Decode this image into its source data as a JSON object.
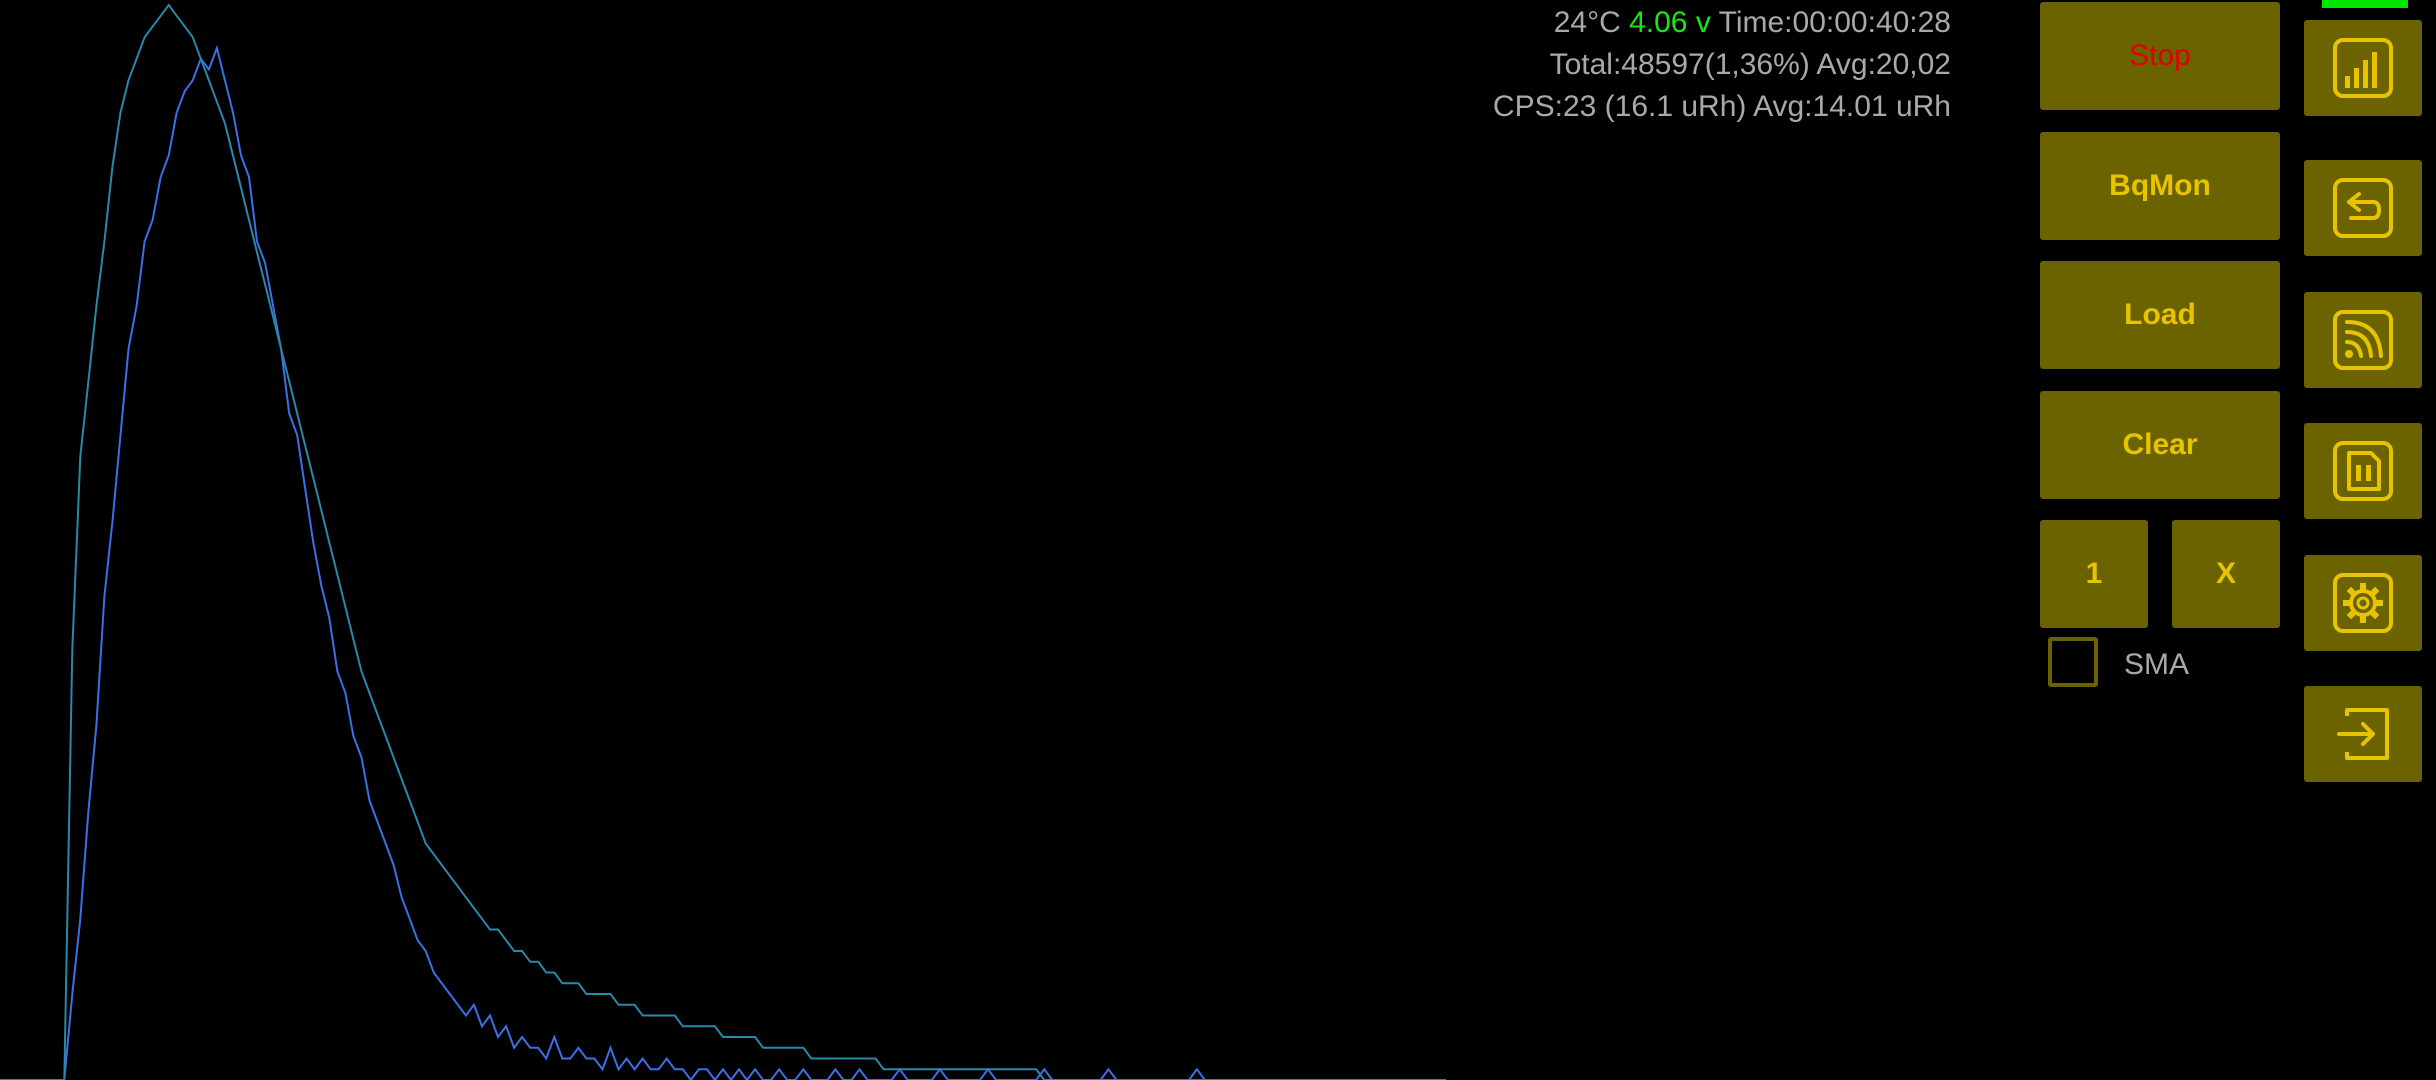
{
  "status": {
    "temperature": "24°C",
    "voltage": "4.06 v",
    "time": "Time:00:00:40:28",
    "total": "Total:48597(1,36%) Avg:20,02",
    "cps": "CPS:23 (16.1 uRh) Avg:14.01 uRh"
  },
  "controls": {
    "stop_label": "Stop",
    "bqmon_label": "BqMon",
    "load_label": "Load",
    "clear_label": "Clear",
    "one_label": "1",
    "x_label": "X",
    "sma_label": "SMA",
    "sma_checked": false
  },
  "side_icons": [
    "spectrum-bars-icon",
    "back-arrow-icon",
    "broadcast-icon",
    "sd-card-icon",
    "gear-icon",
    "exit-icon"
  ],
  "colors": {
    "background": "#000000",
    "button_bg": "#6b6300",
    "button_text": "#e8c300",
    "stop_text": "#e10000",
    "voltage_text": "#19e619",
    "status_text": "#a9a9a9",
    "series_current": "#3d6fe8",
    "series_total": "#2a88a8",
    "battery_indicator": "#00e600"
  },
  "chart_data": {
    "type": "line",
    "series": [
      {
        "values": [
          0,
          0,
          0,
          0,
          0,
          0,
          0,
          0,
          0,
          8,
          15,
          25,
          33,
          45,
          52,
          60,
          68,
          72,
          78,
          80,
          84,
          86,
          90,
          92,
          93,
          95,
          94,
          96,
          93,
          90,
          86,
          84,
          78,
          76,
          72,
          68,
          62,
          60,
          55,
          50,
          46,
          43,
          38,
          36,
          32,
          30,
          26,
          24,
          22,
          20,
          17,
          15,
          13,
          12,
          10,
          9,
          8,
          7,
          6,
          7,
          5,
          6,
          4,
          5,
          3,
          4,
          3,
          3,
          2,
          4,
          2,
          2,
          3,
          2,
          2,
          1,
          3,
          1,
          2,
          1,
          2,
          1,
          1,
          2,
          1,
          1,
          0,
          1,
          1,
          0,
          1,
          0,
          1,
          0,
          1,
          0,
          0,
          1,
          0,
          0,
          1,
          0,
          0,
          0,
          1,
          0,
          0,
          1,
          0,
          0,
          0,
          0,
          1,
          0,
          0,
          0,
          0,
          1,
          0,
          0,
          0,
          0,
          0,
          1,
          0,
          0,
          0,
          0,
          0,
          0,
          1,
          0,
          0,
          0,
          0,
          0,
          0,
          0,
          1,
          0,
          0,
          0,
          0,
          0,
          0,
          0,
          0,
          0,
          0,
          1,
          0,
          0,
          0,
          0,
          0,
          0,
          0,
          0,
          0,
          0,
          0,
          0,
          0,
          0,
          0,
          0,
          0,
          0,
          0,
          0,
          0,
          0,
          0,
          0,
          0,
          0,
          0,
          0,
          0,
          0
        ]
      },
      {
        "values": [
          0,
          0,
          0,
          0,
          0,
          0,
          0,
          0,
          0,
          40,
          58,
          65,
          72,
          78,
          85,
          90,
          93,
          95,
          97,
          98,
          99,
          100,
          99,
          98,
          97,
          95,
          93,
          91,
          89,
          86,
          83,
          80,
          77,
          74,
          71,
          68,
          65,
          62,
          59,
          56,
          53,
          50,
          47,
          44,
          41,
          38,
          36,
          34,
          32,
          30,
          28,
          26,
          24,
          22,
          21,
          20,
          19,
          18,
          17,
          16,
          15,
          14,
          14,
          13,
          12,
          12,
          11,
          11,
          10,
          10,
          9,
          9,
          9,
          8,
          8,
          8,
          8,
          7,
          7,
          7,
          6,
          6,
          6,
          6,
          6,
          5,
          5,
          5,
          5,
          5,
          4,
          4,
          4,
          4,
          4,
          3,
          3,
          3,
          3,
          3,
          3,
          2,
          2,
          2,
          2,
          2,
          2,
          2,
          2,
          2,
          1,
          1,
          1,
          1,
          1,
          1,
          1,
          1,
          1,
          1,
          1,
          1,
          1,
          1,
          1,
          1,
          1,
          1,
          1,
          1,
          0,
          0,
          0,
          0,
          0,
          0,
          0,
          0,
          0,
          0,
          0,
          0,
          0,
          0,
          0,
          0,
          0,
          0,
          0,
          0,
          0,
          0,
          0,
          0,
          0,
          0,
          0,
          0,
          0,
          0,
          0,
          0,
          0,
          0,
          0,
          0,
          0,
          0,
          0,
          0,
          0,
          0,
          0,
          0,
          0,
          0,
          0,
          0,
          0,
          0,
          0
        ]
      }
    ],
    "xlim": [
      0,
      183
    ],
    "ylim": [
      0,
      100
    ],
    "grid": false,
    "legend": "none"
  }
}
